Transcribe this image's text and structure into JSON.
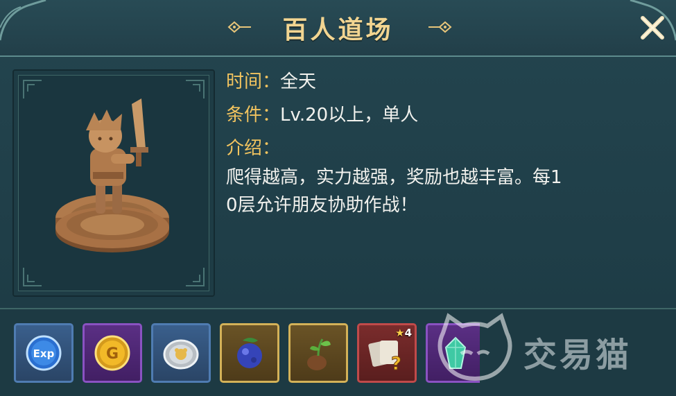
{
  "title": "百人道场",
  "info": {
    "time_label": "时间：",
    "time_value": "全天",
    "cond_label": "条件：",
    "cond_value": "Lv.20以上，单人",
    "intro_label": "介绍：",
    "intro_line1": "爬得越高，实力越强，奖励也越丰富。每1",
    "intro_line2": "0层允许朋友协助作战！"
  },
  "rewards": [
    {
      "name": "exp",
      "icon": "exp-icon",
      "rarity": "blue",
      "icon_text": "Exp"
    },
    {
      "name": "gold",
      "icon": "gold-coin-icon",
      "rarity": "purple",
      "icon_text": "G"
    },
    {
      "name": "silver-coin",
      "icon": "silver-coin-icon",
      "rarity": "blue"
    },
    {
      "name": "blue-berry",
      "icon": "blue-berry-icon",
      "rarity": "gold"
    },
    {
      "name": "sprout-seed",
      "icon": "sprout-icon",
      "rarity": "gold"
    },
    {
      "name": "mystery-cards",
      "icon": "card-pack-icon",
      "rarity": "red",
      "stars": "4"
    },
    {
      "name": "green-crystal",
      "icon": "crystal-icon",
      "rarity": "purple"
    }
  ],
  "watermark": "交易猫",
  "colors": {
    "accent": "#f2c45f",
    "title": "#f2d591",
    "panel": "#21404a"
  }
}
